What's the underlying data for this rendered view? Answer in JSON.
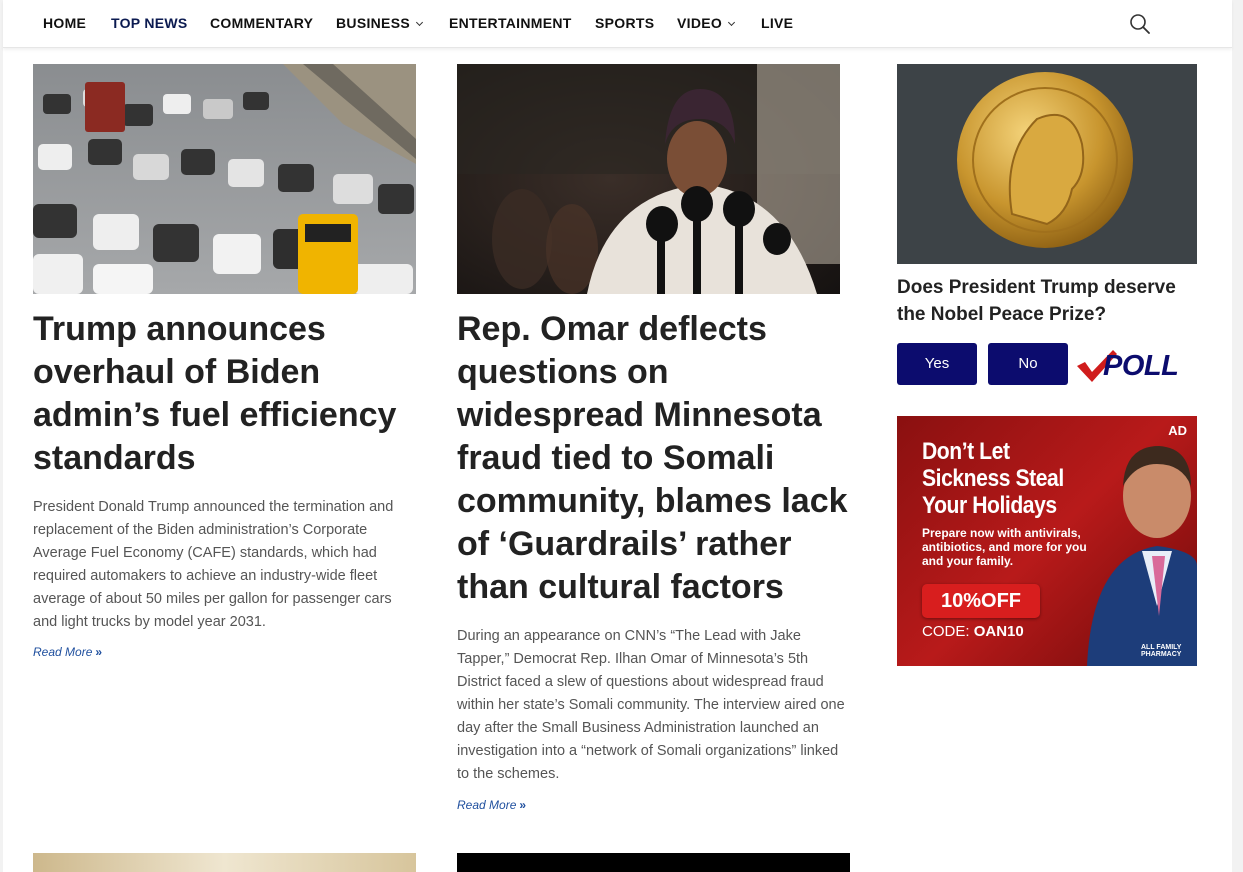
{
  "nav": {
    "items": [
      {
        "label": "HOME"
      },
      {
        "label": "TOP NEWS"
      },
      {
        "label": "COMMENTARY"
      },
      {
        "label": "BUSINESS"
      },
      {
        "label": "ENTERTAINMENT"
      },
      {
        "label": "SPORTS"
      },
      {
        "label": "VIDEO"
      },
      {
        "label": "LIVE"
      }
    ]
  },
  "articles": [
    {
      "headline": "Trump announces overhaul of Biden admin’s fuel efficiency standards",
      "excerpt": "President Donald Trump announced the termination and replacement of the Biden administration’s Corporate Average Fuel Economy (CAFE) standards, which had required automakers to achieve an industry-wide fleet average of about 50 miles per gallon for passenger cars and light trucks by model year 2031.",
      "read_more": "Read More",
      "image_alt": "Highway traffic with school bus"
    },
    {
      "headline": "Rep. Omar deflects questions on widespread Minnesota fraud tied to Somali community, blames lack of ‘Guardrails’ rather than cultural factors",
      "excerpt": "During an appearance on CNN’s “The Lead with Jake Tapper,” Democrat Rep. Ilhan Omar of Minnesota’s 5th District faced a slew of questions about widespread fraud within her state’s Somali community. The interview aired one day after the Small Business Administration launched an investigation into a “network of Somali organizations” linked to the schemes.",
      "read_more": "Read More",
      "image_alt": "Speaker at microphones"
    }
  ],
  "poll": {
    "question": "Does President Trump deserve the Nobel Peace Prize?",
    "yes_label": "Yes",
    "no_label": "No",
    "logo_text": "POLL"
  },
  "ad": {
    "badge": "AD",
    "headline": "Don’t Let Sickness Steal Your Holidays",
    "subtext": "Prepare now with antivirals, antibiotics, and more for you and your family.",
    "offer": "10%OFF",
    "code_label": "CODE:",
    "code": "OAN10",
    "brand": "ALL FAMILY PHARMACY"
  },
  "colors": {
    "nav_active": "#0b1a50",
    "poll_button": "#0c0c6e",
    "link": "#1f4f9e",
    "ad_red": "#b81a1a"
  }
}
